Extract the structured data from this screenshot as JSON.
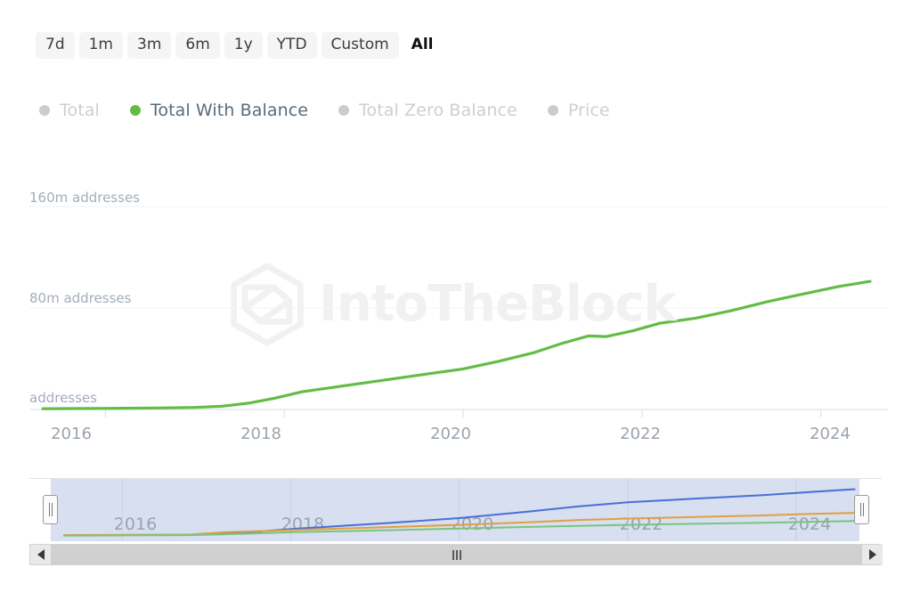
{
  "range_selector": {
    "buttons": [
      {
        "label": "7d",
        "active": false
      },
      {
        "label": "1m",
        "active": false
      },
      {
        "label": "3m",
        "active": false
      },
      {
        "label": "6m",
        "active": false
      },
      {
        "label": "1y",
        "active": false
      },
      {
        "label": "YTD",
        "active": false
      },
      {
        "label": "Custom",
        "active": false
      },
      {
        "label": "All",
        "active": true
      }
    ]
  },
  "legend": {
    "items": [
      {
        "label": "Total",
        "active": false,
        "color": "#cccccc"
      },
      {
        "label": "Total With Balance",
        "active": true,
        "color": "#66bb44"
      },
      {
        "label": "Total Zero Balance",
        "active": false,
        "color": "#cccccc"
      },
      {
        "label": "Price",
        "active": false,
        "color": "#cccccc"
      }
    ]
  },
  "watermark": {
    "text": "IntoTheBlock",
    "color": "#f0f1f2"
  },
  "navigator": {
    "years": [
      "2016",
      "2018",
      "2020",
      "2022",
      "2024"
    ],
    "selection_start_pct": 0,
    "selection_end_pct": 100,
    "series_colors": {
      "total": "#4a6fd4",
      "total_with_balance": "#e0a040",
      "total_zero_balance": "#7bc47f"
    }
  },
  "scrollbar": {
    "left_arrow": "◀",
    "right_arrow": "▶",
    "thumb_grip": "|||"
  },
  "chart_data": {
    "type": "line",
    "title": "",
    "xlabel": "",
    "ylabel": "addresses",
    "grid": true,
    "legend_position": "top",
    "ylim": [
      0,
      180
    ],
    "y_unit": "m addresses",
    "ytick_labels": [
      "160m addresses",
      "80m addresses",
      "addresses"
    ],
    "ytick_values": [
      160,
      80,
      0
    ],
    "xtick_labels": [
      "2016",
      "2018",
      "2020",
      "2022",
      "2024"
    ],
    "xtick_values": [
      2016,
      2018,
      2020,
      2022,
      2024
    ],
    "series": [
      {
        "name": "Total With Balance",
        "color": "#63bc46",
        "visible": true,
        "x": [
          2015.3,
          2015.8,
          2016.2,
          2016.6,
          2017.0,
          2017.3,
          2017.6,
          2017.9,
          2018.2,
          2018.5,
          2018.9,
          2019.2,
          2019.6,
          2020.0,
          2020.4,
          2020.8,
          2021.1,
          2021.4,
          2021.6,
          2021.9,
          2022.2,
          2022.6,
          2023.0,
          2023.4,
          2023.8,
          2024.2,
          2024.55
        ],
        "y": [
          0.6,
          0.8,
          1.0,
          1.2,
          1.6,
          2.5,
          5.0,
          9.0,
          14.0,
          17.0,
          21.0,
          24.0,
          28.0,
          32.0,
          38.0,
          45.0,
          52.0,
          58.0,
          57.5,
          62.0,
          68.0,
          72.0,
          78.0,
          85.0,
          91.0,
          97.0,
          101.0
        ]
      },
      {
        "name": "Total",
        "color": "#cccccc",
        "visible": false,
        "x": [],
        "y": []
      },
      {
        "name": "Total Zero Balance",
        "color": "#cccccc",
        "visible": false,
        "x": [],
        "y": []
      },
      {
        "name": "Price",
        "color": "#cccccc",
        "visible": false,
        "x": [],
        "y": []
      }
    ]
  }
}
